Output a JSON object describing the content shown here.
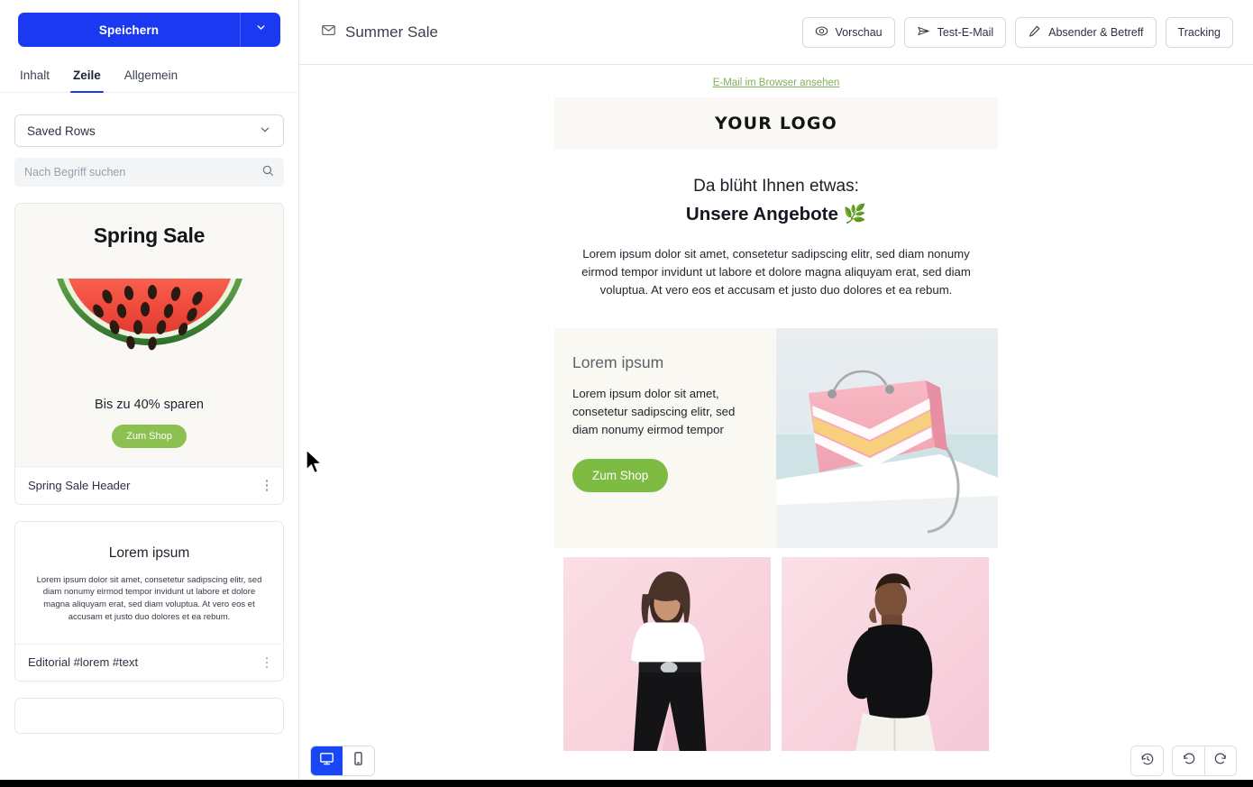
{
  "sidebar": {
    "save_label": "Speichern",
    "save_caret_icon": "chevron-down-icon",
    "tabs": [
      {
        "label": "Inhalt",
        "active": false
      },
      {
        "label": "Zeile",
        "active": true
      },
      {
        "label": "Allgemein",
        "active": false
      }
    ],
    "select": {
      "value": "Saved Rows",
      "icon": "chevron-down-icon"
    },
    "search": {
      "placeholder": "Nach Begriff suchen",
      "value": "",
      "icon": "search-icon"
    },
    "cards": [
      {
        "title": "Spring Sale Header",
        "menu_icon": "kebab-menu-icon",
        "preview": {
          "heading": "Spring Sale",
          "image": "watermelon-slice",
          "subtext": "Bis zu 40% sparen",
          "button": "Zum Shop"
        }
      },
      {
        "title": "Editorial #lorem #text",
        "menu_icon": "kebab-menu-icon",
        "preview": {
          "heading": "Lorem ipsum",
          "body": "Lorem ipsum dolor sit amet, consetetur sadipscing elitr, sed diam nonumy eirmod tempor invidunt ut labore et dolore magna aliquyam erat, sed diam voluptua. At vero eos et accusam et justo duo dolores et ea rebum."
        }
      }
    ]
  },
  "topbar": {
    "mail_icon": "envelope-icon",
    "title": "Summer Sale",
    "actions": [
      {
        "label": "Vorschau",
        "icon": "eye-icon"
      },
      {
        "label": "Test-E-Mail",
        "icon": "paper-plane-icon"
      },
      {
        "label": "Absender & Betreff",
        "icon": "pencil-icon"
      },
      {
        "label": "Tracking",
        "icon": ""
      }
    ]
  },
  "email": {
    "preheader": "E-Mail im Browser ansehen",
    "logo": "YOUR LOGO",
    "heading_line1": "Da blüht Ihnen etwas:",
    "heading_line2": "Unsere Angebote 🌿",
    "intro": "Lorem ipsum dolor sit amet, consetetur sadipscing elitr, sed diam nonumy eirmod tempor invidunt ut labore et dolore magna aliquyam erat, sed diam voluptua. At vero eos et accusam et justo duo dolores et ea rebum.",
    "product": {
      "title": "Lorem ipsum",
      "body": "Lorem ipsum dolor sit amet, consetetur sadipscing elitr, sed diam nonumy eirmod tempor",
      "button": "Zum Shop",
      "image": "pink-handbag-on-pedestal"
    },
    "gallery": [
      {
        "image": "woman-white-tee-black-skirt-pink-background"
      },
      {
        "image": "man-black-sweater-white-pants-pink-background"
      }
    ]
  },
  "footer_controls": {
    "devices": [
      {
        "name": "desktop",
        "icon": "monitor-icon",
        "active": true
      },
      {
        "name": "mobile",
        "icon": "smartphone-icon",
        "active": false
      }
    ],
    "history": [
      {
        "name": "version-history",
        "icon": "clock-history-icon"
      },
      {
        "name": "undo",
        "icon": "undo-icon"
      },
      {
        "name": "redo",
        "icon": "redo-icon"
      }
    ]
  },
  "colors": {
    "accent_blue": "#1a39f0",
    "cta_green": "#7dbb42",
    "link_green": "#7eb356",
    "band_cream": "#faf8f5",
    "panel_cream": "#faf8f2"
  }
}
